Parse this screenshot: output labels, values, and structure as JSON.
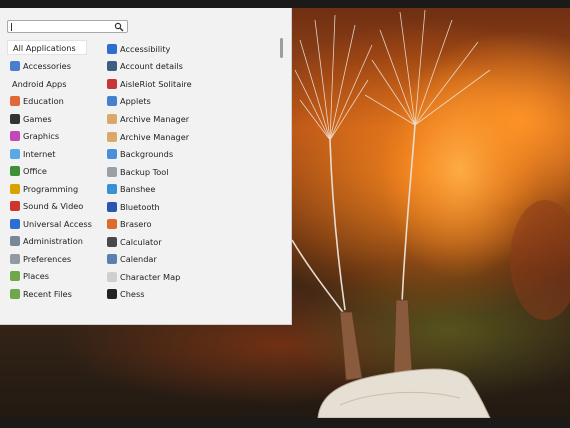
{
  "search": {
    "placeholder": "",
    "value": ""
  },
  "categories": [
    {
      "label": "All Applications",
      "icon": "",
      "color": ""
    },
    {
      "label": "Accessories",
      "icon": "accessories-icon",
      "color": "#4a7fd0"
    },
    {
      "label": "Android Apps",
      "icon": "",
      "color": ""
    },
    {
      "label": "Education",
      "icon": "education-icon",
      "color": "#e0693a"
    },
    {
      "label": "Games",
      "icon": "games-icon",
      "color": "#333333"
    },
    {
      "label": "Graphics",
      "icon": "graphics-icon",
      "color": "#c447b8"
    },
    {
      "label": "Internet",
      "icon": "internet-icon",
      "color": "#5aa8e6"
    },
    {
      "label": "Office",
      "icon": "office-icon",
      "color": "#3f8f3a"
    },
    {
      "label": "Programming",
      "icon": "programming-icon",
      "color": "#d8a200"
    },
    {
      "label": "Sound & Video",
      "icon": "sound-video-icon",
      "color": "#d0342c"
    },
    {
      "label": "Universal Access",
      "icon": "universal-access-icon",
      "color": "#2d6ed2"
    },
    {
      "label": "Administration",
      "icon": "administration-icon",
      "color": "#7a8896"
    },
    {
      "label": "Preferences",
      "icon": "preferences-icon",
      "color": "#8f9aa3"
    },
    {
      "label": "Places",
      "icon": "places-icon",
      "color": "#6fa84a"
    },
    {
      "label": "Recent Files",
      "icon": "recent-files-icon",
      "color": "#6fa84a"
    }
  ],
  "apps": [
    {
      "label": "Accessibility",
      "icon": "accessibility-icon",
      "color": "#2d6ed2"
    },
    {
      "label": "Account details",
      "icon": "account-details-icon",
      "color": "#3e5d80"
    },
    {
      "label": "AisleRiot Solitaire",
      "icon": "solitaire-icon",
      "color": "#c8363a"
    },
    {
      "label": "Applets",
      "icon": "applets-icon",
      "color": "#4a7fd0"
    },
    {
      "label": "Archive Manager",
      "icon": "archive-manager-icon",
      "color": "#d9a86a"
    },
    {
      "label": "Archive Manager",
      "icon": "archive-manager-icon",
      "color": "#d9a86a"
    },
    {
      "label": "Backgrounds",
      "icon": "backgrounds-icon",
      "color": "#4a90d9"
    },
    {
      "label": "Backup Tool",
      "icon": "backup-tool-icon",
      "color": "#9aa0a6"
    },
    {
      "label": "Banshee",
      "icon": "banshee-icon",
      "color": "#3b8fd8"
    },
    {
      "label": "Bluetooth",
      "icon": "bluetooth-icon",
      "color": "#2b56b0"
    },
    {
      "label": "Brasero",
      "icon": "brasero-icon",
      "color": "#e06a2a"
    },
    {
      "label": "Calculator",
      "icon": "calculator-icon",
      "color": "#4a4a4a"
    },
    {
      "label": "Calendar",
      "icon": "calendar-icon",
      "color": "#5b7fb0"
    },
    {
      "label": "Character Map",
      "icon": "character-map-icon",
      "color": "#cfcfcf"
    },
    {
      "label": "Chess",
      "icon": "chess-icon",
      "color": "#222222"
    }
  ]
}
